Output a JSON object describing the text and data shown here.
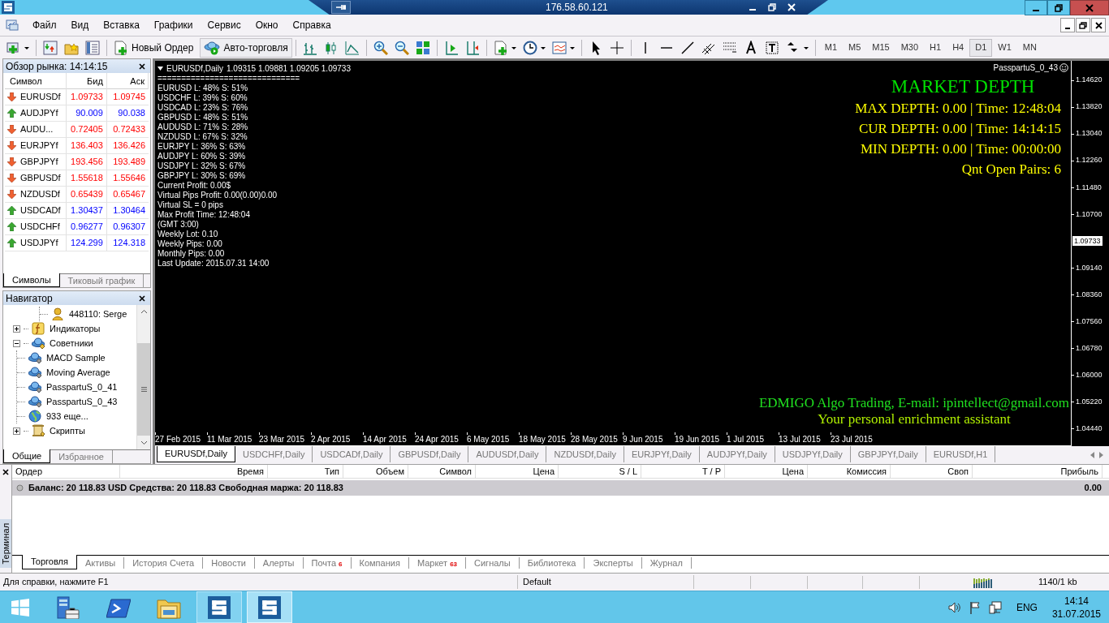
{
  "remote_bar": {
    "address": "176.58.60.121"
  },
  "menu": [
    "Файл",
    "Вид",
    "Вставка",
    "Графики",
    "Сервис",
    "Окно",
    "Справка"
  ],
  "toolbar": {
    "buttons": [
      "Новый Ордер",
      "Авто-торговля"
    ],
    "timeframes": [
      {
        "label": "M1",
        "selected": false
      },
      {
        "label": "M5",
        "selected": false
      },
      {
        "label": "M15",
        "selected": false
      },
      {
        "label": "M30",
        "selected": false
      },
      {
        "label": "H1",
        "selected": false
      },
      {
        "label": "H4",
        "selected": false
      },
      {
        "label": "D1",
        "selected": true
      },
      {
        "label": "W1",
        "selected": false
      },
      {
        "label": "MN",
        "selected": false
      }
    ]
  },
  "market_watch": {
    "title": "Обзор рынка: 14:14:15",
    "columns": [
      "Символ",
      "Бид",
      "Аск"
    ],
    "rows": [
      {
        "symbol": "EURUSDf",
        "bid": "1.09733",
        "ask": "1.09745",
        "kind": "down"
      },
      {
        "symbol": "AUDJPYf",
        "bid": "90.009",
        "ask": "90.038",
        "kind": "up"
      },
      {
        "symbol": "AUDU...",
        "bid": "0.72405",
        "ask": "0.72433",
        "kind": "down"
      },
      {
        "symbol": "EURJPYf",
        "bid": "136.403",
        "ask": "136.426",
        "kind": "down"
      },
      {
        "symbol": "GBPJPYf",
        "bid": "193.456",
        "ask": "193.489",
        "kind": "down"
      },
      {
        "symbol": "GBPUSDf",
        "bid": "1.55618",
        "ask": "1.55646",
        "kind": "down"
      },
      {
        "symbol": "NZDUSDf",
        "bid": "0.65439",
        "ask": "0.65467",
        "kind": "down"
      },
      {
        "symbol": "USDCADf",
        "bid": "1.30437",
        "ask": "1.30464",
        "kind": "up"
      },
      {
        "symbol": "USDCHFf",
        "bid": "0.96277",
        "ask": "0.96307",
        "kind": "up"
      },
      {
        "symbol": "USDJPYf",
        "bid": "124.299",
        "ask": "124.318",
        "kind": "up"
      }
    ],
    "tabs": [
      {
        "label": "Символы",
        "selected": true
      },
      {
        "label": "Тиковый график",
        "selected": false
      }
    ]
  },
  "navigator": {
    "title": "Навигатор",
    "tree": [
      {
        "children": [
          {
            "label": "448110: Serge",
            "kind": "account"
          }
        ]
      },
      {
        "label": "Индикаторы",
        "kind": "indicators",
        "expanded": false
      },
      {
        "label": "Советники",
        "kind": "experts",
        "expanded": true,
        "children": [
          {
            "label": "MACD Sample",
            "kind": "expert"
          },
          {
            "label": "Moving Average",
            "kind": "expert"
          },
          {
            "label": "PasspartuS_0_41",
            "kind": "expert"
          },
          {
            "label": "PasspartuS_0_43",
            "kind": "expert"
          },
          {
            "label": "933 еще...",
            "kind": "more"
          }
        ]
      },
      {
        "label": "Скрипты",
        "kind": "scripts",
        "expanded": false
      }
    ],
    "tabs": [
      {
        "label": "Общие",
        "selected": true
      },
      {
        "label": "Избранное",
        "selected": false
      }
    ]
  },
  "chart": {
    "symbol": "EURUSDf,Daily",
    "ohlc": "1.09315 1.09881 1.09205 1.09733",
    "expert": "PasspartuS_0_43",
    "info_lines": [
      "==============================",
      "EURUSD L: 48% S: 51%",
      "USDCHF L: 39% S: 60%",
      "USDCAD L: 23% S: 76%",
      "GBPUSD L: 48% S: 51%",
      "AUDUSD L: 71% S: 28%",
      "NZDUSD L: 67% S: 32%",
      "EURJPY L: 36% S: 63%",
      "AUDJPY L: 60% S: 39%",
      "USDJPY L: 32% S: 67%",
      "GBPJPY L: 30% S: 69%",
      "Current Profit: 0.00$",
      "Virtual Pips Profit: 0.00(0.00)0.00",
      "Virtual SL = 0 pips",
      "Max Profit Time: 12:48:04",
      "(GMT 3:00)",
      "Weekly Lot: 0.10",
      "Weekly Pips: 0.00",
      "Monthly Pips: 0.00",
      "Last Update: 2015.07.31 14:00"
    ],
    "depth_title": "MARKET DEPTH",
    "depth_lines": [
      "MAX DEPTH: 0.00 | Time: 12:48:04",
      "CUR DEPTH: 0.00 | Time: 14:14:15",
      "MIN DEPTH: 0.00 | Time: 00:00:00",
      "Qnt Open Pairs: 6"
    ],
    "footer": [
      "EDMIGO Algo Trading, E-mail: ipintellect@gmail.com",
      "Your personal enrichment assistant"
    ],
    "price_labels": [
      {
        "label": "1.14620",
        "kind": "tick"
      },
      {
        "label": "1.13820",
        "kind": "tick"
      },
      {
        "label": "1.13040",
        "kind": "tick"
      },
      {
        "label": "1.12260",
        "kind": "tick"
      },
      {
        "label": "1.11480",
        "kind": "tick"
      },
      {
        "label": "1.10700",
        "kind": "tick"
      },
      {
        "label": "1.09733",
        "kind": "current"
      },
      {
        "label": "1.09140",
        "kind": "tick"
      },
      {
        "label": "1.08360",
        "kind": "tick"
      },
      {
        "label": "1.07560",
        "kind": "tick"
      },
      {
        "label": "1.06780",
        "kind": "tick"
      },
      {
        "label": "1.06000",
        "kind": "tick"
      },
      {
        "label": "1.05220",
        "kind": "tick"
      },
      {
        "label": "1.04440",
        "kind": "tick"
      }
    ],
    "date_labels": [
      "27 Feb 2015",
      "11 Mar 2015",
      "23 Mar 2015",
      "2 Apr 2015",
      "14 Apr 2015",
      "24 Apr 2015",
      "6 May 2015",
      "18 May 2015",
      "28 May 2015",
      "9 Jun 2015",
      "19 Jun 2015",
      "1 Jul 2015",
      "13 Jul 2015",
      "23 Jul 2015"
    ]
  },
  "chart_tabs": [
    {
      "label": "EURUSDf,Daily",
      "selected": true
    },
    {
      "label": "USDCHFf,Daily",
      "selected": false
    },
    {
      "label": "USDCADf,Daily",
      "selected": false
    },
    {
      "label": "GBPUSDf,Daily",
      "selected": false
    },
    {
      "label": "AUDUSDf,Daily",
      "selected": false
    },
    {
      "label": "NZDUSDf,Daily",
      "selected": false
    },
    {
      "label": "EURJPYf,Daily",
      "selected": false
    },
    {
      "label": "AUDJPYf,Daily",
      "selected": false
    },
    {
      "label": "USDJPYf,Daily",
      "selected": false
    },
    {
      "label": "GBPJPYf,Daily",
      "selected": false
    },
    {
      "label": "EURUSDf,H1",
      "selected": false
    }
  ],
  "terminal": {
    "side_label": "Терминал",
    "columns": [
      "Ордер",
      "Время",
      "Тип",
      "Объем",
      "Символ",
      "Цена",
      "S / L",
      "T / P",
      "Цена",
      "Комиссия",
      "Своп",
      "Прибыль"
    ],
    "balance": "Баланс: 20 118.83 USD  Средства: 20 118.83  Свободная маржа: 20 118.83",
    "profit": "0.00",
    "tabs": [
      {
        "label": "Торговля",
        "selected": true
      },
      {
        "label": "Активы",
        "selected": false
      },
      {
        "label": "История Счета",
        "selected": false
      },
      {
        "label": "Новости",
        "selected": false
      },
      {
        "label": "Алерты",
        "selected": false
      },
      {
        "label": "Почта",
        "badge": "6",
        "selected": false
      },
      {
        "label": "Компания",
        "selected": false
      },
      {
        "label": "Маркет",
        "badge": "63",
        "selected": false
      },
      {
        "label": "Сигналы",
        "selected": false
      },
      {
        "label": "Библиотека",
        "selected": false
      },
      {
        "label": "Эксперты",
        "selected": false
      },
      {
        "label": "Журнал",
        "selected": false
      }
    ]
  },
  "status_bar": {
    "help": "Для справки, нажмите F1",
    "profile": "Default",
    "traffic": "1140/1 kb"
  },
  "taskbar": {
    "apps": [
      {
        "kind": "server",
        "selected": false
      },
      {
        "kind": "shell",
        "selected": false
      },
      {
        "kind": "folder",
        "selected": false
      },
      {
        "kind": "terminal",
        "selected": false
      },
      {
        "kind": "terminal",
        "selected": true
      }
    ],
    "language": "ENG",
    "time": "14:14",
    "date": "31.07.2015"
  }
}
